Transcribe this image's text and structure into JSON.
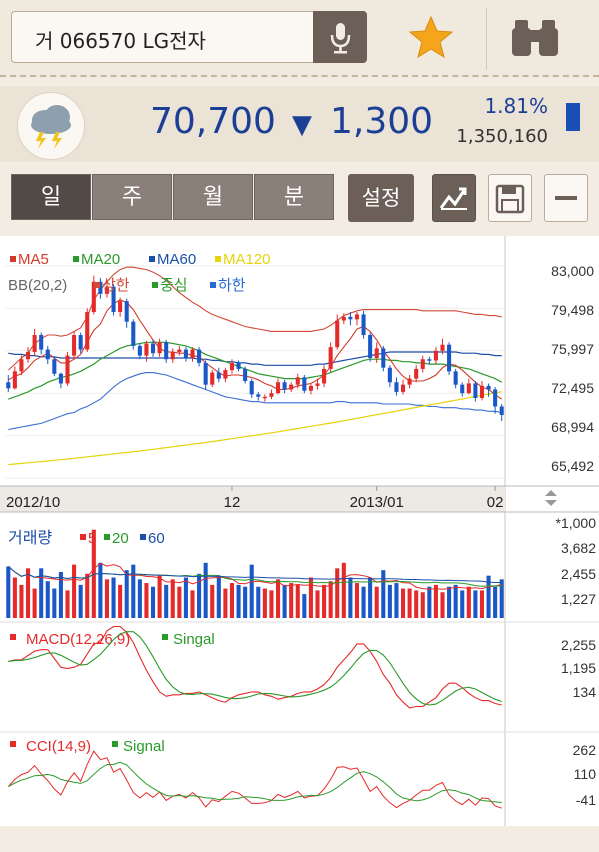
{
  "search": {
    "text": "거 066570 LG전자"
  },
  "icons": {
    "mic": "microphone-icon",
    "star": "star-icon",
    "binoculars": "binoculars-icon",
    "weather": "thunderstorm-weather-icon"
  },
  "quote": {
    "price": "70,700",
    "direction_symbol": "▼",
    "change": "1,300",
    "rate": "1.81%",
    "volume": "1,350,160"
  },
  "period_tabs": [
    {
      "label": "일",
      "active": true
    },
    {
      "label": "주",
      "active": false
    },
    {
      "label": "월",
      "active": false
    },
    {
      "label": "분",
      "active": false
    }
  ],
  "settings_label": "설정",
  "colors": {
    "up": "#e52a2a",
    "down": "#1a58c8",
    "price_text": "#1c3f96",
    "ma5": "#d23a2a",
    "ma20": "#2a9a2a",
    "ma60": "#1c4fa8",
    "ma120": "#e6d30c"
  },
  "chart_data": {
    "type": "candlestick",
    "legend": {
      "ma5": "MA5",
      "ma20": "MA20",
      "ma60": "MA60",
      "ma120": "MA120",
      "bb": "BB(20,2)",
      "bb_upper": "상한",
      "bb_mid": "중심",
      "bb_lower": "하한"
    },
    "price_axis": [
      "83,000",
      "79,498",
      "75,997",
      "72,495",
      "68,994",
      "65,492"
    ],
    "ylim": [
      65492,
      83000
    ],
    "x_labels": [
      "2012/10",
      "12",
      "2013/01",
      "02"
    ],
    "candles": [
      [
        73400,
        72900,
        74000,
        72600
      ],
      [
        72900,
        74300,
        74700,
        72800
      ],
      [
        74300,
        75300,
        75600,
        74000
      ],
      [
        75300,
        75900,
        76300,
        75000
      ],
      [
        75900,
        77300,
        77800,
        75600
      ],
      [
        77300,
        76100,
        77500,
        75700
      ],
      [
        76100,
        75300,
        76400,
        74900
      ],
      [
        75300,
        74100,
        75500,
        73900
      ],
      [
        74100,
        73300,
        74200,
        72900
      ],
      [
        73300,
        75600,
        75900,
        73100
      ],
      [
        75600,
        77300,
        77600,
        75300
      ],
      [
        77300,
        76100,
        77500,
        75800
      ],
      [
        76100,
        79200,
        79500,
        75900
      ],
      [
        79200,
        81700,
        82200,
        79000
      ],
      [
        81700,
        80700,
        82000,
        80300
      ],
      [
        80700,
        81300,
        81800,
        80400
      ],
      [
        81300,
        79200,
        81500,
        78900
      ],
      [
        79200,
        80100,
        80400,
        78800
      ],
      [
        80100,
        78400,
        80300,
        77900
      ],
      [
        78400,
        76400,
        78600,
        76100
      ],
      [
        76400,
        75600,
        76600,
        75300
      ],
      [
        75600,
        76600,
        76800,
        75100
      ],
      [
        76600,
        75800,
        76900,
        75500
      ],
      [
        75800,
        76700,
        77000,
        75500
      ],
      [
        76700,
        75300,
        76900,
        75000
      ],
      [
        75300,
        75900,
        76200,
        75000
      ],
      [
        75900,
        76100,
        76400,
        75600
      ],
      [
        76100,
        75400,
        76300,
        75100
      ],
      [
        75400,
        76100,
        76300,
        75100
      ],
      [
        76100,
        75000,
        76300,
        74700
      ],
      [
        75000,
        73200,
        75200,
        72800
      ],
      [
        73200,
        74200,
        74400,
        73000
      ],
      [
        74200,
        73700,
        74600,
        73400
      ],
      [
        73700,
        74400,
        74600,
        73400
      ],
      [
        74400,
        75000,
        75300,
        74100
      ],
      [
        75000,
        74500,
        75200,
        74300
      ],
      [
        74500,
        73500,
        74700,
        73300
      ],
      [
        73500,
        72400,
        73700,
        72100
      ],
      [
        72400,
        72200,
        72600,
        71900
      ],
      [
        72200,
        72200,
        72400,
        71800
      ],
      [
        72200,
        72500,
        72800,
        72000
      ],
      [
        72500,
        73400,
        73700,
        72400
      ],
      [
        73400,
        72800,
        73600,
        72500
      ],
      [
        72800,
        73200,
        73400,
        72600
      ],
      [
        73200,
        73800,
        74100,
        72900
      ],
      [
        73800,
        72700,
        74000,
        72500
      ],
      [
        72700,
        73100,
        73300,
        72400
      ],
      [
        73100,
        73300,
        73700,
        72800
      ],
      [
        73300,
        74500,
        74800,
        73000
      ],
      [
        74500,
        76300,
        76700,
        74200
      ],
      [
        76300,
        78500,
        79000,
        76100
      ],
      [
        78500,
        78800,
        79100,
        78200
      ],
      [
        78800,
        78600,
        79200,
        78100
      ],
      [
        78600,
        79000,
        79200,
        78100
      ],
      [
        79000,
        77300,
        79300,
        77000
      ],
      [
        77300,
        75400,
        77500,
        75100
      ],
      [
        75400,
        76200,
        76700,
        75000
      ],
      [
        76200,
        74600,
        76400,
        74300
      ],
      [
        74600,
        73400,
        74800,
        73000
      ],
      [
        73400,
        72600,
        73800,
        72300
      ],
      [
        72600,
        73200,
        73600,
        72400
      ],
      [
        73200,
        73700,
        74000,
        72900
      ],
      [
        73700,
        74500,
        74800,
        73400
      ],
      [
        74500,
        75300,
        75600,
        74200
      ],
      [
        75300,
        75200,
        75500,
        74900
      ],
      [
        75200,
        76000,
        76300,
        74900
      ],
      [
        76000,
        76500,
        77000,
        75700
      ],
      [
        76500,
        74300,
        76700,
        74000
      ],
      [
        74300,
        73200,
        74500,
        72900
      ],
      [
        73200,
        72500,
        73400,
        72200
      ],
      [
        72500,
        73300,
        73700,
        72400
      ],
      [
        73300,
        72100,
        73500,
        71800
      ],
      [
        72100,
        73100,
        73500,
        71900
      ],
      [
        73100,
        72800,
        73300,
        72200
      ],
      [
        72800,
        71400,
        73000,
        70800
      ],
      [
        71400,
        70700,
        71600,
        70200
      ]
    ],
    "ma5": [
      73600,
      73900,
      74100,
      74600,
      75200,
      75500,
      75800,
      75400,
      75000,
      75000,
      75300,
      75700,
      76700,
      77700,
      78200,
      79300,
      79900,
      80200,
      80000,
      79400,
      78500,
      77700,
      76900,
      76200,
      75900,
      75900,
      75800,
      75800,
      75600,
      75500,
      75000,
      74600,
      74200,
      73900,
      74000,
      74000,
      73900,
      73800,
      73600,
      73300,
      73100,
      72800,
      72800,
      72900,
      73100,
      73200,
      73300,
      73600,
      74000,
      74700,
      75600,
      76300,
      77000,
      77800,
      78000,
      77600,
      76900,
      76000,
      75300,
      74500,
      73900,
      73500,
      73500,
      73500,
      73700,
      74000,
      74600,
      74900,
      74800,
      74400,
      73900,
      73400,
      73000,
      72800,
      72400,
      72000
    ],
    "ma20": [
      72000,
      72200,
      72400,
      72600,
      72900,
      73100,
      73400,
      73600,
      73800,
      73900,
      74100,
      74300,
      74600,
      74900,
      75300,
      75600,
      75900,
      76200,
      76400,
      76500,
      76600,
      76700,
      76700,
      76700,
      76700,
      76600,
      76500,
      76400,
      76200,
      76000,
      75700,
      75500,
      75300,
      75100,
      74900,
      74700,
      74500,
      74300,
      74100,
      74000,
      73900,
      73800,
      73700,
      73700,
      73700,
      73700,
      73800,
      73900,
      74000,
      74200,
      74400,
      74600,
      74800,
      75000,
      75200,
      75300,
      75300,
      75300,
      75200,
      75200,
      75100,
      75100,
      75000,
      75000,
      74900,
      74900,
      74900,
      74800,
      74700,
      74600,
      74500,
      74300,
      74100,
      73900,
      73700,
      73400
    ],
    "ma60": [
      75800,
      75700,
      75700,
      75600,
      75600,
      75500,
      75500,
      75500,
      75400,
      75400,
      75400,
      75400,
      75400,
      75400,
      75400,
      75400,
      75400,
      75400,
      75400,
      75400,
      75400,
      75400,
      75400,
      75400,
      75400,
      75400,
      75400,
      75400,
      75400,
      75300,
      75300,
      75200,
      75200,
      75100,
      75100,
      75000,
      75000,
      74900,
      74900,
      74800,
      74800,
      74800,
      74800,
      74800,
      74800,
      74800,
      74800,
      74900,
      74900,
      75000,
      75100,
      75200,
      75300,
      75400,
      75500,
      75600,
      75700,
      75800,
      75900,
      75900,
      75900,
      75900,
      75900,
      75900,
      75900,
      75900,
      75900,
      75900,
      75900,
      75800,
      75800,
      75800,
      75700,
      75700,
      75600,
      75600
    ],
    "ma120": [
      66600,
      66650,
      66700,
      66750,
      66800,
      66850,
      66900,
      66950,
      67000,
      67060,
      67120,
      67180,
      67240,
      67300,
      67360,
      67420,
      67480,
      67540,
      67600,
      67660,
      67720,
      67790,
      67860,
      67930,
      68000,
      68070,
      68140,
      68210,
      68280,
      68350,
      68420,
      68500,
      68580,
      68660,
      68740,
      68820,
      68900,
      68980,
      69060,
      69140,
      69220,
      69310,
      69400,
      69490,
      69580,
      69670,
      69760,
      69850,
      69940,
      70030,
      70120,
      70220,
      70320,
      70420,
      70520,
      70620,
      70720,
      70820,
      70920,
      71020,
      71120,
      71220,
      71320,
      71420,
      71520,
      71620,
      71720,
      71820,
      71920,
      72020,
      72120,
      72220,
      72320,
      72420,
      72520,
      72620
    ],
    "bb_upper": [
      74400,
      74900,
      75400,
      75800,
      76600,
      77000,
      77300,
      77300,
      77200,
      77300,
      77600,
      77900,
      78800,
      80200,
      81000,
      81700,
      82300,
      82700,
      82900,
      82900,
      82800,
      82700,
      82500,
      82200,
      81800,
      81300,
      80800,
      80400,
      80000,
      79700,
      79300,
      79000,
      78800,
      78600,
      78400,
      78200,
      78000,
      77900,
      77800,
      77700,
      77600,
      77600,
      77600,
      77600,
      77600,
      77600,
      77600,
      77700,
      77800,
      78100,
      78500,
      78900,
      79100,
      79300,
      79400,
      79400,
      79400,
      79400,
      79400,
      79400,
      79400,
      79400,
      79400,
      79300,
      79300,
      79300,
      79300,
      79300,
      79300,
      79200,
      79100,
      79000,
      79000,
      78900,
      78900,
      78800
    ],
    "bb_lower": [
      69500,
      69600,
      69700,
      69800,
      69900,
      70000,
      70200,
      70400,
      70600,
      70800,
      70900,
      71200,
      71400,
      71700,
      72000,
      72500,
      73000,
      73400,
      73700,
      73900,
      74100,
      74200,
      74200,
      74100,
      74000,
      73800,
      73600,
      73400,
      73200,
      73000,
      72800,
      72600,
      72400,
      72200,
      72100,
      72000,
      71900,
      71800,
      71800,
      71700,
      71700,
      71700,
      71700,
      71700,
      71700,
      71700,
      71700,
      71700,
      71700,
      71700,
      71800,
      71800,
      71700,
      71700,
      71700,
      71700,
      71700,
      71600,
      71600,
      71600,
      71600,
      71600,
      71500,
      71500,
      71400,
      71400,
      71300,
      71300,
      71300,
      71200,
      71200,
      71100,
      71100,
      71000,
      71000,
      70900
    ],
    "volume_panel": {
      "title": "거래량",
      "legend": [
        "5",
        "20",
        "60"
      ],
      "axis": [
        "*1,000",
        "3,682",
        "2,455",
        "1,227"
      ],
      "values": [
        2800,
        2200,
        1800,
        2700,
        1600,
        2700,
        2000,
        1600,
        2500,
        1500,
        2900,
        1800,
        2400,
        4800,
        3000,
        2100,
        2200,
        1800,
        2600,
        2900,
        2100,
        1900,
        1700,
        2300,
        1800,
        2100,
        1700,
        2200,
        1500,
        2400,
        3000,
        1800,
        2300,
        1600,
        1900,
        1800,
        1700,
        2900,
        1700,
        1600,
        1500,
        2100,
        1800,
        1900,
        1800,
        1300,
        2200,
        1500,
        1800,
        2000,
        2700,
        3000,
        2200,
        1900,
        1700,
        2200,
        1700,
        2600,
        1800,
        1900,
        1600,
        1600,
        1500,
        1400,
        1700,
        1800,
        1400,
        1700,
        1800,
        1500,
        1700,
        1500,
        1500,
        2300,
        1700,
        2100
      ]
    },
    "macd_panel": {
      "legend": [
        "MACD(12,26,9)",
        "Singal"
      ],
      "axis": [
        "2,255",
        "1,195",
        "134"
      ]
    },
    "cci_panel": {
      "legend": [
        "CCI(14,9)",
        "Signal"
      ],
      "axis": [
        "262",
        "110",
        "-41"
      ]
    }
  }
}
